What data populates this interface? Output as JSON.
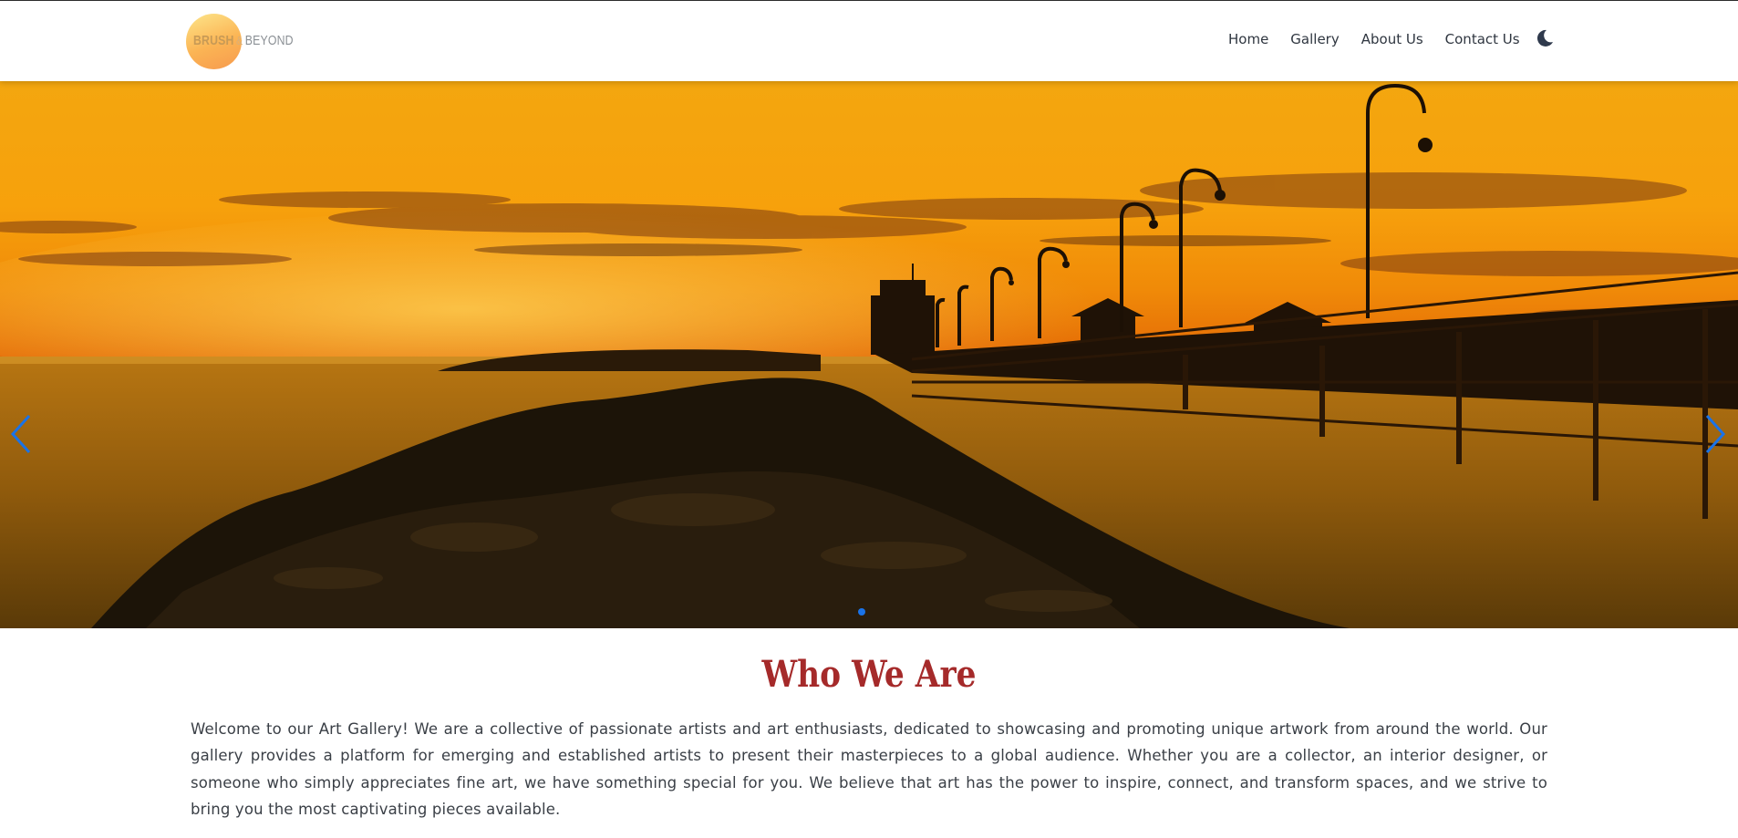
{
  "brand": {
    "logo_word1": "BRUSH",
    "logo_amp": "&",
    "logo_word2": "BEYOND",
    "gradient_colors": [
      "#fde58a",
      "#fbb454",
      "#f79a4e"
    ]
  },
  "nav": {
    "items": [
      {
        "label": "Home"
      },
      {
        "label": "Gallery"
      },
      {
        "label": "About Us"
      },
      {
        "label": "Contact Us"
      }
    ],
    "theme_toggle_icon": "moon-icon"
  },
  "carousel": {
    "slide_subject": "sunset over pier",
    "prev_icon": "chevron-left-icon",
    "next_icon": "chevron-right-icon",
    "active_slide": 1,
    "accent_color": "#1a73e8"
  },
  "about": {
    "title": "Who We Are",
    "title_color": "#a52a2a",
    "paragraph": "Welcome to our Art Gallery! We are a collective of passionate artists and art enthusiasts, dedicated to showcasing and promoting unique artwork from around the world. Our gallery provides a platform for emerging and established artists to present their masterpieces to a global audience. Whether you are a collector, an interior designer, or someone who simply appreciates fine art, we have something special for you. We believe that art has the power to inspire, connect, and transform spaces, and we strive to bring you the most captivating pieces available."
  }
}
